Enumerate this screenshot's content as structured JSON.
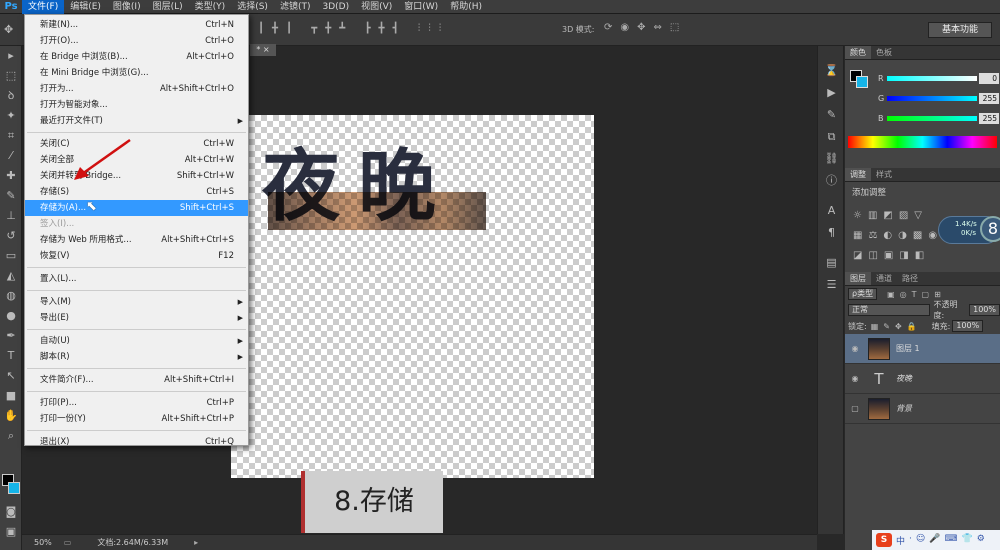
{
  "app": {
    "logo": "Ps"
  },
  "menubar": {
    "items": [
      "文件(F)",
      "编辑(E)",
      "图像(I)",
      "图层(L)",
      "类型(Y)",
      "选择(S)",
      "滤镜(T)",
      "3D(D)",
      "视图(V)",
      "窗口(W)",
      "帮助(H)"
    ]
  },
  "options_bar": {
    "mode_3d_label": "3D 模式:",
    "workspace": "基本功能"
  },
  "document": {
    "tab_label": "* ×",
    "artwork_text": "夜晚"
  },
  "file_menu": {
    "groups": [
      [
        {
          "label": "新建(N)...",
          "shortcut": "Ctrl+N"
        },
        {
          "label": "打开(O)...",
          "shortcut": "Ctrl+O"
        },
        {
          "label": "在 Bridge 中浏览(B)...",
          "shortcut": "Alt+Ctrl+O"
        },
        {
          "label": "在 Mini Bridge 中浏览(G)...",
          "shortcut": ""
        },
        {
          "label": "打开为...",
          "shortcut": "Alt+Shift+Ctrl+O"
        },
        {
          "label": "打开为智能对象...",
          "shortcut": ""
        },
        {
          "label": "最近打开文件(T)",
          "shortcut": "",
          "submenu": true
        }
      ],
      [
        {
          "label": "关闭(C)",
          "shortcut": "Ctrl+W"
        },
        {
          "label": "关闭全部",
          "shortcut": "Alt+Ctrl+W"
        },
        {
          "label": "关闭并转到 Bridge...",
          "shortcut": "Shift+Ctrl+W"
        },
        {
          "label": "存储(S)",
          "shortcut": "Ctrl+S"
        },
        {
          "label": "存储为(A)...",
          "shortcut": "Shift+Ctrl+S",
          "highlighted": true
        },
        {
          "label": "签入(I)...",
          "shortcut": "",
          "disabled": true
        },
        {
          "label": "存储为 Web 所用格式...",
          "shortcut": "Alt+Shift+Ctrl+S"
        },
        {
          "label": "恢复(V)",
          "shortcut": "F12"
        }
      ],
      [
        {
          "label": "置入(L)...",
          "shortcut": ""
        }
      ],
      [
        {
          "label": "导入(M)",
          "shortcut": "",
          "submenu": true
        },
        {
          "label": "导出(E)",
          "shortcut": "",
          "submenu": true
        }
      ],
      [
        {
          "label": "自动(U)",
          "shortcut": "",
          "submenu": true
        },
        {
          "label": "脚本(R)",
          "shortcut": "",
          "submenu": true
        }
      ],
      [
        {
          "label": "文件简介(F)...",
          "shortcut": "Alt+Shift+Ctrl+I"
        }
      ],
      [
        {
          "label": "打印(P)...",
          "shortcut": "Ctrl+P"
        },
        {
          "label": "打印一份(Y)",
          "shortcut": "Alt+Shift+Ctrl+P"
        }
      ],
      [
        {
          "label": "退出(X)",
          "shortcut": "Ctrl+Q"
        }
      ]
    ]
  },
  "caption": {
    "text": "8.存储"
  },
  "status": {
    "zoom": "50%",
    "doc_size": "文档:2.64M/6.33M"
  },
  "color_panel": {
    "tabs": [
      "颜色",
      "色板"
    ],
    "channels": [
      {
        "label": "R",
        "value": "0"
      },
      {
        "label": "G",
        "value": "255"
      },
      {
        "label": "B",
        "value": "255"
      }
    ],
    "fg_color": "#000000",
    "bg_color": "#14b4e8"
  },
  "adjust_panel": {
    "tabs": [
      "调整",
      "样式"
    ],
    "title": "添加调整"
  },
  "net_widget": {
    "up": "1.4K/s",
    "down": "0K/s",
    "badge": "8"
  },
  "layers_panel": {
    "tabs": [
      "图层",
      "通道",
      "路径"
    ],
    "filter_label": "ρ类型",
    "blend_mode": "正常",
    "opacity_label": "不透明度:",
    "opacity_value": "100%",
    "lock_label": "锁定:",
    "fill_label": "填充:",
    "fill_value": "100%",
    "layers": [
      {
        "name": "图层 1",
        "type": "image",
        "selected": true,
        "visible": true
      },
      {
        "name": "夜晚",
        "type": "text",
        "selected": false,
        "visible": true
      },
      {
        "name": "背景",
        "type": "image",
        "selected": false,
        "visible": false
      }
    ]
  },
  "taskbar": {
    "logo": "S",
    "items": [
      "中",
      "·",
      "☺",
      "🎤",
      "⌨",
      "👕",
      "⚙"
    ]
  }
}
